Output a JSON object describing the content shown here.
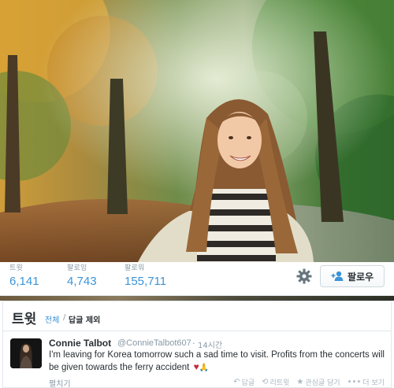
{
  "profile_stats": [
    {
      "label": "트윗",
      "value": "6,141"
    },
    {
      "label": "팔로잉",
      "value": "4,743"
    },
    {
      "label": "팔로워",
      "value": "155,711"
    }
  ],
  "follow_button": {
    "label": "팔로우"
  },
  "tweets_section": {
    "title": "트윗",
    "tab_all": "전체",
    "tab_separator": "/",
    "tab_no_replies": "답글 제외"
  },
  "tweet": {
    "name": "Connie Talbot",
    "handle": "@ConnieTalbot607",
    "separator": "·",
    "time": "14시간",
    "text": "I'm leaving for Korea tomorrow such a sad time to visit. Profits from the concerts will be given towards the ferry accident",
    "heart": "♥",
    "prayer": "🙏",
    "expand": "펼치기",
    "actions": [
      {
        "icon": "reply-icon",
        "glyph": "↶",
        "label": "답글"
      },
      {
        "icon": "retweet-icon",
        "glyph": "⟲",
        "label": "리트윗"
      },
      {
        "icon": "favorite-icon",
        "glyph": "★",
        "label": "관심글 담기"
      },
      {
        "icon": "more-icon",
        "glyph": "•••",
        "label": "더 보기"
      }
    ]
  },
  "colors": {
    "link": "#3b94d9",
    "muted": "#8899a6",
    "text": "#292f33",
    "heart": "#c42b3a"
  }
}
